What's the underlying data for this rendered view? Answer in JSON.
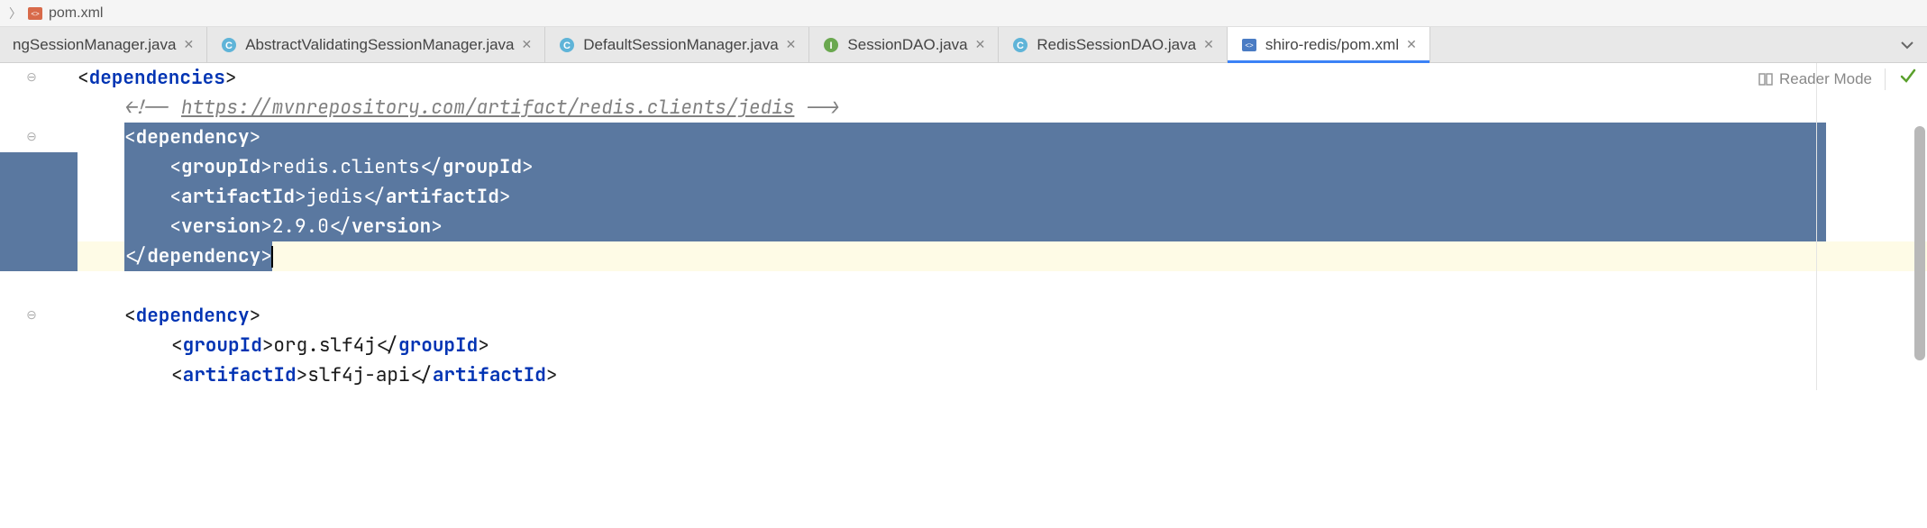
{
  "breadcrumb": {
    "file": "pom.xml"
  },
  "tabs": [
    {
      "label": "ngSessionManager.java",
      "icon": "class"
    },
    {
      "label": "AbstractValidatingSessionManager.java",
      "icon": "class"
    },
    {
      "label": "DefaultSessionManager.java",
      "icon": "class"
    },
    {
      "label": "SessionDAO.java",
      "icon": "interface"
    },
    {
      "label": "RedisSessionDAO.java",
      "icon": "class"
    },
    {
      "label": "shiro-redis/pom.xml",
      "icon": "xml",
      "active": true
    }
  ],
  "editor_tools": {
    "reader_mode": "Reader Mode"
  },
  "code": {
    "l1_open": "dependencies",
    "l2_comment_prefix": "<!-- ",
    "l2_comment_url": "https://mvnrepository.com/artifact/redis.clients/jedis",
    "l2_comment_suffix": " -->",
    "l3_dep_open": "dependency",
    "l4_groupId_tag": "groupId",
    "l4_groupId_val": "redis.clients",
    "l5_artifactId_tag": "artifactId",
    "l5_artifactId_val": "jedis",
    "l6_version_tag": "version",
    "l6_version_val": "2.9.0",
    "l7_dep_close": "dependency",
    "l9_dep_open": "dependency",
    "l10_groupId_tag": "groupId",
    "l10_groupId_val": "org.slf4j",
    "l11_artifactId_tag": "artifactId",
    "l11_artifactId_val": "slf4j-api"
  }
}
